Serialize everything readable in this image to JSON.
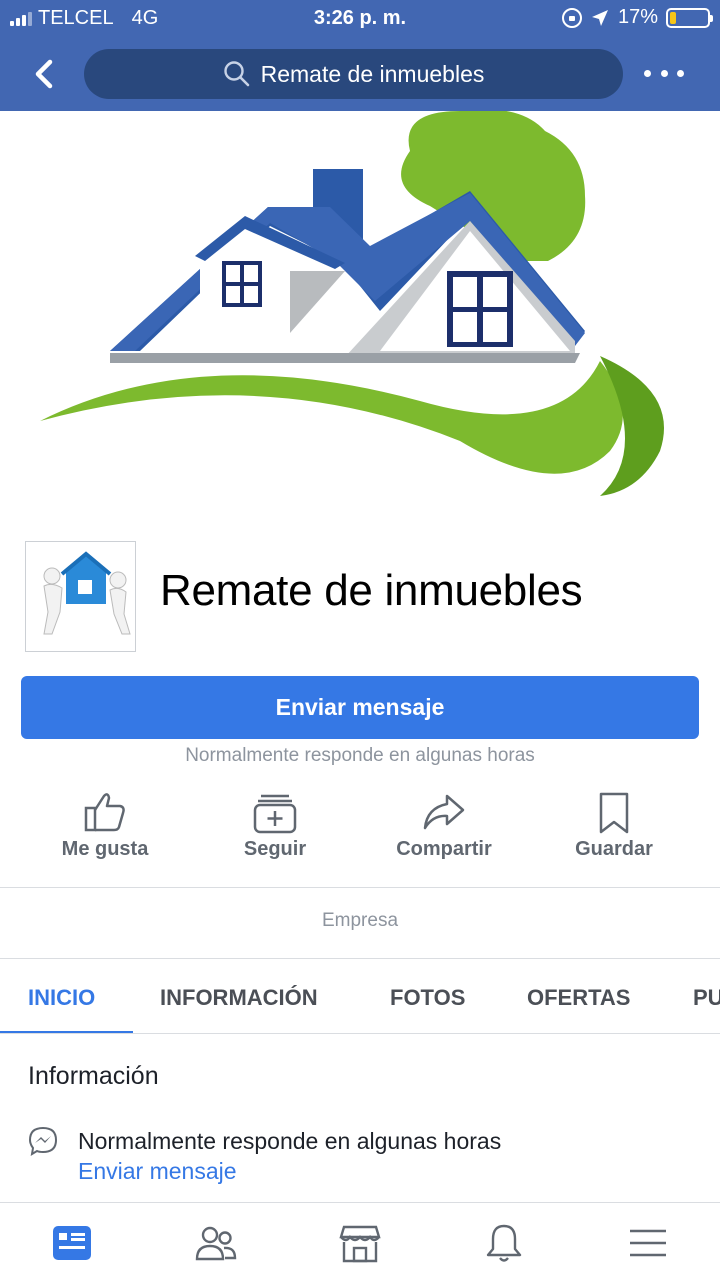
{
  "status_bar": {
    "carrier": "TELCEL",
    "network": "4G",
    "time": "3:26 p. m.",
    "battery": "17%",
    "battery_level": 0.17
  },
  "nav": {
    "search_text": "Remate de inmuebles"
  },
  "page": {
    "name": "Remate de inmuebles",
    "message_button": "Enviar mensaje",
    "response_note": "Normalmente responde en algunas horas",
    "category": "Empresa"
  },
  "actions": [
    {
      "label": "Me gusta",
      "icon": "thumbs-up-icon"
    },
    {
      "label": "Seguir",
      "icon": "follow-icon"
    },
    {
      "label": "Compartir",
      "icon": "share-icon"
    },
    {
      "label": "Guardar",
      "icon": "bookmark-icon"
    }
  ],
  "tabs": [
    "INICIO",
    "INFORMACIÓN",
    "FOTOS",
    "OFERTAS",
    "PU"
  ],
  "active_tab": "INICIO",
  "info": {
    "title": "Información",
    "response_text": "Normalmente responde en algunas horas",
    "send_message_link": "Enviar mensaje"
  },
  "bottom_nav": [
    "news-feed-icon",
    "friends-icon",
    "marketplace-icon",
    "notifications-icon",
    "menu-icon"
  ],
  "colors": {
    "header_blue": "#4267b2",
    "search_bg": "#29487d",
    "accent_blue": "#3578e5",
    "house_blue": "#2c5aa8",
    "grass_green": "#7dba2e"
  }
}
